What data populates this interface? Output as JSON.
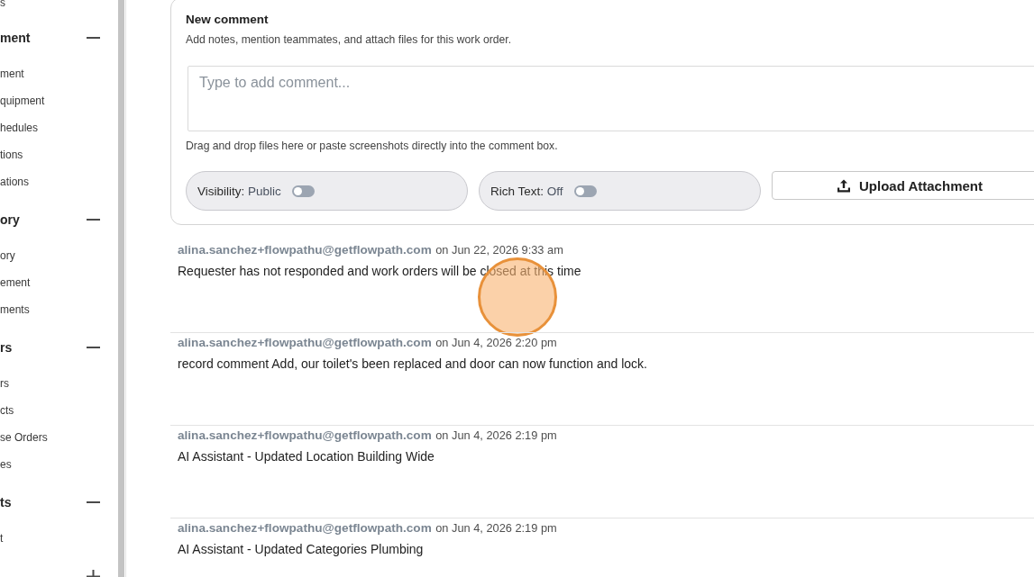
{
  "sidebar": {
    "leading_items": [
      "s"
    ],
    "sections": [
      {
        "title": "ment",
        "expanded": true,
        "items": [
          "ment",
          "quipment",
          "hedules",
          "tions",
          "ations"
        ]
      },
      {
        "title": "ory",
        "expanded": true,
        "items": [
          "ory",
          "ement",
          "ments"
        ]
      },
      {
        "title": "rs",
        "expanded": true,
        "items": [
          "rs",
          "cts",
          "se Orders",
          "es"
        ]
      },
      {
        "title": "ts",
        "expanded": true,
        "items": [
          "t"
        ]
      },
      {
        "expanded": false
      }
    ]
  },
  "comment_form": {
    "title": "New comment",
    "description": "Add notes, mention teammates, and attach files for this work order.",
    "input": {
      "placeholder": "Type to add comment..."
    },
    "hint": "Drag and drop files here or paste screenshots directly into the comment box.",
    "toggles": [
      {
        "label": "Visibility:",
        "value": "Public",
        "on": false
      },
      {
        "label": "Rich Text:",
        "value": "Off",
        "on": false
      }
    ],
    "upload_button": "Upload Attachment"
  },
  "comments": [
    {
      "author": "alina.sanchez+flowpathu@getflowpath.com",
      "date": "on Jun 22, 2026 9:33 am",
      "text": "Requester has not responded and work orders will be closed at this time"
    },
    {
      "author": "alina.sanchez+flowpathu@getflowpath.com",
      "date": "on Jun 4, 2026 2:20 pm",
      "text": "record comment Add, our toilet's been replaced and door can now function and lock."
    },
    {
      "author": "alina.sanchez+flowpathu@getflowpath.com",
      "date": "on Jun 4, 2026 2:19 pm",
      "text": "AI Assistant - Updated Location Building Wide"
    },
    {
      "author": "alina.sanchez+flowpathu@getflowpath.com",
      "date": "on Jun 4, 2026 2:19 pm",
      "text": "AI Assistant - Updated Categories Plumbing"
    }
  ]
}
